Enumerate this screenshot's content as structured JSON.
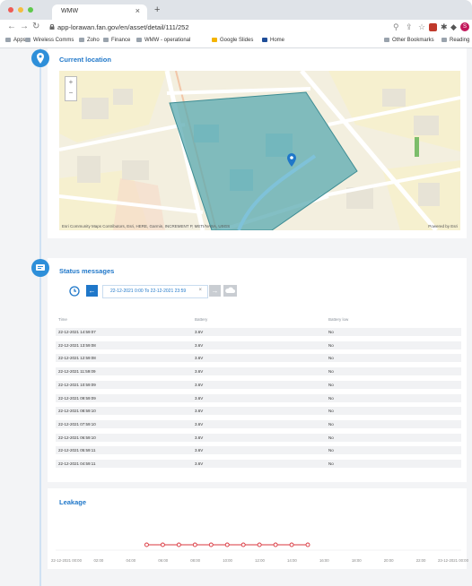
{
  "browser": {
    "tab_title": "WMW",
    "tab_close": "×",
    "new_tab": "+",
    "url": "app-lorawan.fan.gov/en/asset/detail/111/252",
    "bookmarks": [
      "Apps",
      "Wireless Comms",
      "Zoho",
      "Finance",
      "WMW - operational",
      "Google Slides",
      "Home"
    ],
    "bookmarks_right": [
      "Other Bookmarks",
      "Reading"
    ],
    "profile_initial": "S",
    "colors": {
      "close": "#ee5b55",
      "minimize": "#f5bd3f",
      "maximize": "#5fc94c",
      "accent": "#1f77c9"
    }
  },
  "location": {
    "title": "Current location",
    "icon": "map-pin-icon",
    "zoom_in": "+",
    "zoom_out": "−",
    "attribution": "Esri Community Maps Contributors, Esri, HERE, Garmin, INCREMENT P, METI/NASA, USGS",
    "powered_by": "Powered by Esri"
  },
  "status": {
    "title": "Status messages",
    "icon": "message-icon",
    "date_range": "22-12-2021 0:00 To 22-12-2021 23:59",
    "clear": "×",
    "prev": "←",
    "next": "→",
    "columns": [
      "Time",
      "Battery",
      "Battery low"
    ],
    "rows": [
      [
        "22-12-2021 14:59:07",
        "3.6V",
        "No"
      ],
      [
        "22-12-2021 13:59:08",
        "3.6V",
        "No"
      ],
      [
        "22-12-2021 12:59:08",
        "3.6V",
        "No"
      ],
      [
        "22-12-2021 11:59:09",
        "3.6V",
        "No"
      ],
      [
        "22-12-2021 10:59:09",
        "3.6V",
        "No"
      ],
      [
        "22-12-2021 09:59:09",
        "3.6V",
        "No"
      ],
      [
        "22-12-2021 08:59:10",
        "3.6V",
        "No"
      ],
      [
        "22-12-2021 07:59:10",
        "3.6V",
        "No"
      ],
      [
        "22-12-2021 06:59:10",
        "3.6V",
        "No"
      ],
      [
        "22-12-2021 05:59:11",
        "3.6V",
        "No"
      ],
      [
        "22-12-2021 04:59:11",
        "3.6V",
        "No"
      ]
    ]
  },
  "leakage": {
    "title": "Leakage",
    "x_ticks": [
      "22-12-2021 00:00",
      "02:00",
      "04:00",
      "06:00",
      "08:00",
      "10:00",
      "12:00",
      "14:00",
      "16:00",
      "18:00",
      "20:00",
      "22:00",
      "23-12-2021 00:00"
    ],
    "line_color": "#d9363e"
  },
  "chart_data": {
    "type": "line",
    "title": "Leakage",
    "xlabel": "",
    "ylabel": "",
    "x": [
      "04:59",
      "05:59",
      "06:59",
      "07:59",
      "08:59",
      "09:59",
      "10:59",
      "11:59",
      "12:59",
      "13:59",
      "14:59"
    ],
    "x_range_hours": [
      0,
      24
    ],
    "x_hours": [
      4.98,
      5.98,
      6.98,
      7.98,
      8.98,
      9.98,
      10.98,
      11.98,
      12.98,
      13.98,
      14.98
    ],
    "series": [
      {
        "values": [
          0,
          0,
          0,
          0,
          0,
          0,
          0,
          0,
          0,
          0,
          0
        ]
      }
    ]
  }
}
